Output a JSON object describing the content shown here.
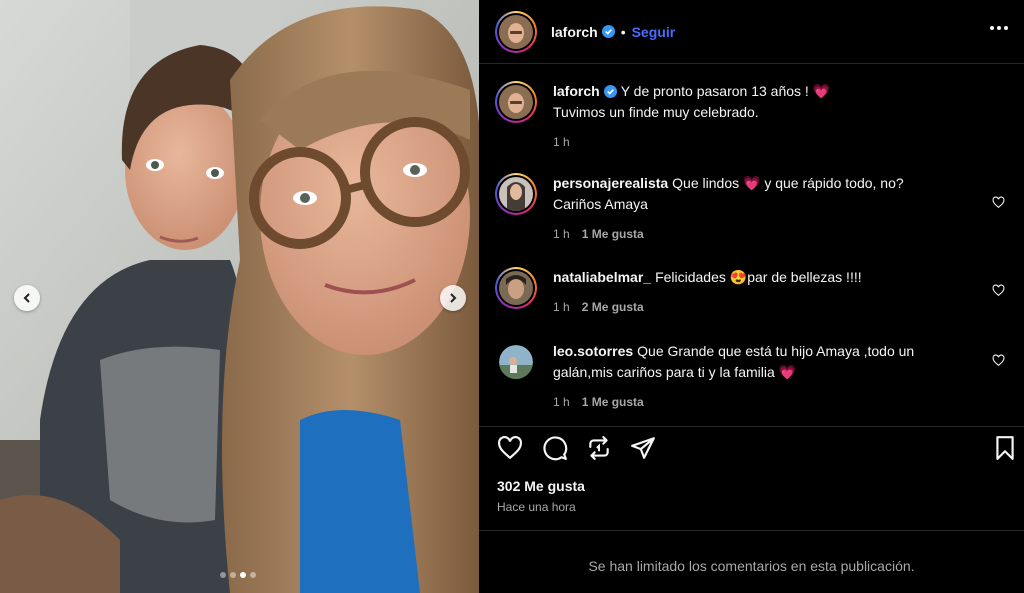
{
  "post": {
    "username": "laforch",
    "follow_label": "Seguir",
    "caption_line1": "Y de pronto pasaron 13 años !",
    "caption_line2": "Tuvimos un finde muy celebrado.",
    "caption_time": "1 h",
    "likes": "302 Me gusta",
    "posted": "Hace una hora",
    "comments_limited": "Se han limitado los comentarios en esta publicación."
  },
  "carousel": {
    "total_images": 4,
    "active_index": 3
  },
  "comments": [
    {
      "username": "personajerealista",
      "text_a": "Que lindos",
      "emoji_a": "💗",
      "text_b": "y que rápido todo, no?",
      "text_c": "Cariños Amaya",
      "time": "1 h",
      "likes": "1 Me gusta"
    },
    {
      "username": "nataliabelmar_",
      "text_a": "Felicidades",
      "emoji_a": "😍",
      "text_b": "par de bellezas !!!!",
      "time": "1 h",
      "likes": "2 Me gusta"
    },
    {
      "username": "leo.sotorres",
      "text_a": "Que Grande que está tu hijo Amaya ,todo un",
      "text_b": "galán,mis cariños para ti y la familia",
      "emoji_b": "💗",
      "time": "1 h",
      "likes": "1 Me gusta"
    }
  ],
  "icons": {
    "verified": "verified-badge-icon",
    "more": "more-options-icon",
    "heart": "heart-icon",
    "comment": "comment-icon",
    "share": "share-icon",
    "repost": "repost-icon",
    "bookmark": "bookmark-icon"
  },
  "colors": {
    "accent": "#4a6bff",
    "background": "#000000",
    "text": "#f5f5f5",
    "muted": "#a8a8a8",
    "heart_emoji": "#ff3b7a"
  }
}
